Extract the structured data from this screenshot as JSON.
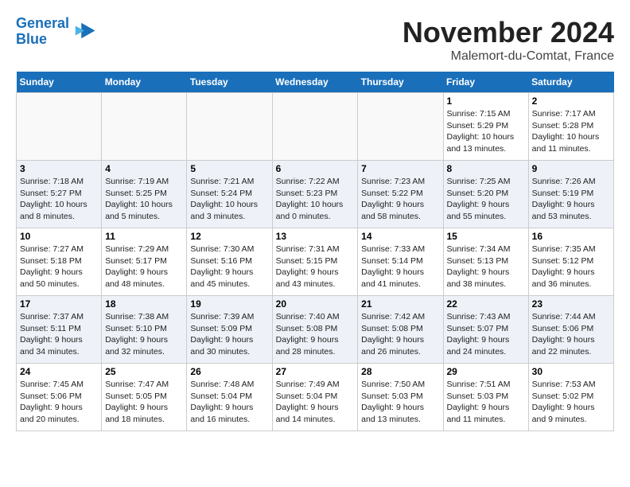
{
  "header": {
    "logo_line1": "General",
    "logo_line2": "Blue",
    "month": "November 2024",
    "location": "Malemort-du-Comtat, France"
  },
  "weekdays": [
    "Sunday",
    "Monday",
    "Tuesday",
    "Wednesday",
    "Thursday",
    "Friday",
    "Saturday"
  ],
  "weeks": [
    [
      {
        "day": "",
        "info": ""
      },
      {
        "day": "",
        "info": ""
      },
      {
        "day": "",
        "info": ""
      },
      {
        "day": "",
        "info": ""
      },
      {
        "day": "",
        "info": ""
      },
      {
        "day": "1",
        "info": "Sunrise: 7:15 AM\nSunset: 5:29 PM\nDaylight: 10 hours and 13 minutes."
      },
      {
        "day": "2",
        "info": "Sunrise: 7:17 AM\nSunset: 5:28 PM\nDaylight: 10 hours and 11 minutes."
      }
    ],
    [
      {
        "day": "3",
        "info": "Sunrise: 7:18 AM\nSunset: 5:27 PM\nDaylight: 10 hours and 8 minutes."
      },
      {
        "day": "4",
        "info": "Sunrise: 7:19 AM\nSunset: 5:25 PM\nDaylight: 10 hours and 5 minutes."
      },
      {
        "day": "5",
        "info": "Sunrise: 7:21 AM\nSunset: 5:24 PM\nDaylight: 10 hours and 3 minutes."
      },
      {
        "day": "6",
        "info": "Sunrise: 7:22 AM\nSunset: 5:23 PM\nDaylight: 10 hours and 0 minutes."
      },
      {
        "day": "7",
        "info": "Sunrise: 7:23 AM\nSunset: 5:22 PM\nDaylight: 9 hours and 58 minutes."
      },
      {
        "day": "8",
        "info": "Sunrise: 7:25 AM\nSunset: 5:20 PM\nDaylight: 9 hours and 55 minutes."
      },
      {
        "day": "9",
        "info": "Sunrise: 7:26 AM\nSunset: 5:19 PM\nDaylight: 9 hours and 53 minutes."
      }
    ],
    [
      {
        "day": "10",
        "info": "Sunrise: 7:27 AM\nSunset: 5:18 PM\nDaylight: 9 hours and 50 minutes."
      },
      {
        "day": "11",
        "info": "Sunrise: 7:29 AM\nSunset: 5:17 PM\nDaylight: 9 hours and 48 minutes."
      },
      {
        "day": "12",
        "info": "Sunrise: 7:30 AM\nSunset: 5:16 PM\nDaylight: 9 hours and 45 minutes."
      },
      {
        "day": "13",
        "info": "Sunrise: 7:31 AM\nSunset: 5:15 PM\nDaylight: 9 hours and 43 minutes."
      },
      {
        "day": "14",
        "info": "Sunrise: 7:33 AM\nSunset: 5:14 PM\nDaylight: 9 hours and 41 minutes."
      },
      {
        "day": "15",
        "info": "Sunrise: 7:34 AM\nSunset: 5:13 PM\nDaylight: 9 hours and 38 minutes."
      },
      {
        "day": "16",
        "info": "Sunrise: 7:35 AM\nSunset: 5:12 PM\nDaylight: 9 hours and 36 minutes."
      }
    ],
    [
      {
        "day": "17",
        "info": "Sunrise: 7:37 AM\nSunset: 5:11 PM\nDaylight: 9 hours and 34 minutes."
      },
      {
        "day": "18",
        "info": "Sunrise: 7:38 AM\nSunset: 5:10 PM\nDaylight: 9 hours and 32 minutes."
      },
      {
        "day": "19",
        "info": "Sunrise: 7:39 AM\nSunset: 5:09 PM\nDaylight: 9 hours and 30 minutes."
      },
      {
        "day": "20",
        "info": "Sunrise: 7:40 AM\nSunset: 5:08 PM\nDaylight: 9 hours and 28 minutes."
      },
      {
        "day": "21",
        "info": "Sunrise: 7:42 AM\nSunset: 5:08 PM\nDaylight: 9 hours and 26 minutes."
      },
      {
        "day": "22",
        "info": "Sunrise: 7:43 AM\nSunset: 5:07 PM\nDaylight: 9 hours and 24 minutes."
      },
      {
        "day": "23",
        "info": "Sunrise: 7:44 AM\nSunset: 5:06 PM\nDaylight: 9 hours and 22 minutes."
      }
    ],
    [
      {
        "day": "24",
        "info": "Sunrise: 7:45 AM\nSunset: 5:06 PM\nDaylight: 9 hours and 20 minutes."
      },
      {
        "day": "25",
        "info": "Sunrise: 7:47 AM\nSunset: 5:05 PM\nDaylight: 9 hours and 18 minutes."
      },
      {
        "day": "26",
        "info": "Sunrise: 7:48 AM\nSunset: 5:04 PM\nDaylight: 9 hours and 16 minutes."
      },
      {
        "day": "27",
        "info": "Sunrise: 7:49 AM\nSunset: 5:04 PM\nDaylight: 9 hours and 14 minutes."
      },
      {
        "day": "28",
        "info": "Sunrise: 7:50 AM\nSunset: 5:03 PM\nDaylight: 9 hours and 13 minutes."
      },
      {
        "day": "29",
        "info": "Sunrise: 7:51 AM\nSunset: 5:03 PM\nDaylight: 9 hours and 11 minutes."
      },
      {
        "day": "30",
        "info": "Sunrise: 7:53 AM\nSunset: 5:02 PM\nDaylight: 9 hours and 9 minutes."
      }
    ]
  ]
}
